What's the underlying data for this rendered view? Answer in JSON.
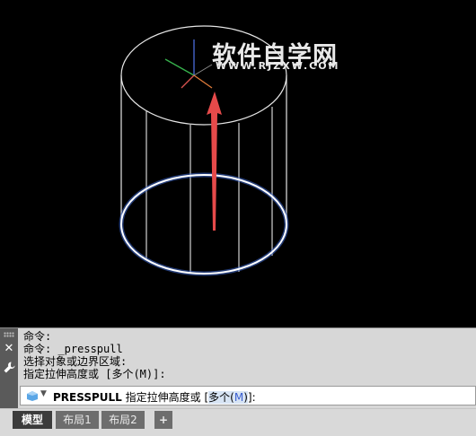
{
  "watermark": {
    "title": "软件自学网",
    "url": "WWW.RJZXW.COM"
  },
  "command_line": {
    "history": [
      "命令:",
      "命令: _presspull",
      "选择对象或边界区域:",
      "指定拉伸高度或 [多个(M)]:"
    ],
    "prompt_command": "PRESSPULL",
    "prompt_text": "指定拉伸高度或",
    "prompt_open": "[",
    "option_label": "多个(",
    "option_key": "M",
    "option_close": ")",
    "prompt_end": "]:"
  },
  "tabs": [
    "模型",
    "布局1",
    "布局2",
    "+"
  ],
  "colors": {
    "viewport_bg": "#000000",
    "arrow": "#e64a4a",
    "highlight_circle": "#8fb4ff"
  }
}
